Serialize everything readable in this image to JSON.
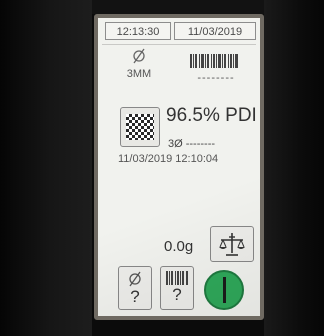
{
  "header": {
    "time": "12:13:30",
    "date": "11/03/2019"
  },
  "diameter": {
    "icon": "diameter-icon",
    "label": "3MM"
  },
  "barcode": {
    "icon": "barcode-icon",
    "value": "--------"
  },
  "result": {
    "pattern_icon": "checkerboard-pattern-icon",
    "pdi_value": "96.5% PDI",
    "count_diameter": "3Ø --------",
    "timestamp": "11/03/2019 12:10:04"
  },
  "weight": {
    "value": "0.0g",
    "scale_icon": "balance-scale-icon"
  },
  "actions": {
    "diameter_query": {
      "icon": "diameter-icon",
      "mark": "?"
    },
    "barcode_query": {
      "icon": "barcode-icon",
      "mark": "?"
    },
    "start": {
      "icon": "power-icon",
      "color": "#2fa85a"
    }
  }
}
